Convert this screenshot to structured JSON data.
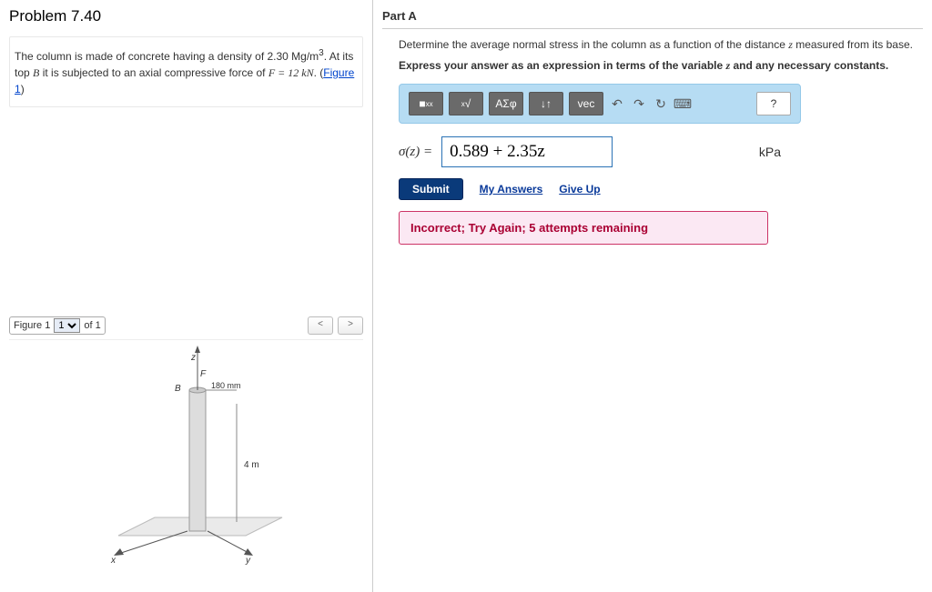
{
  "problem": {
    "title": "Problem 7.40",
    "description_prefix": "The column is made of concrete having a density of 2.30 Mg/m",
    "description_exp": "3",
    "description_mid": ". At its top ",
    "description_var_B": "B",
    "description_after_B": " it is subjected to an axial compressive force of ",
    "description_F": "F = 12 kN",
    "description_suffix": ". (",
    "figure_link_text": "Figure 1",
    "description_close": ")"
  },
  "figure": {
    "label": "Figure 1",
    "selected": "1",
    "of_text": "of 1",
    "prev": "<",
    "next": ">",
    "dim_radius": "180 mm",
    "dim_height": "4 m",
    "axis_x": "x",
    "axis_y": "y",
    "axis_z": "z",
    "label_B": "B",
    "label_F": "F"
  },
  "partA": {
    "title": "Part A",
    "question_prefix": "Determine the average normal stress in the column as a function of the distance ",
    "question_var": "z",
    "question_suffix": " measured from its base.",
    "instruction_prefix": "Express your answer as an expression in terms of the variable ",
    "instruction_var": "z",
    "instruction_suffix": " and any necessary constants.",
    "sigma_label": "σ(z) = ",
    "answer_value": "0.589 + 2.35z",
    "units": "kPa",
    "submit_label": "Submit",
    "my_answers_label": "My Answers",
    "give_up_label": "Give Up",
    "feedback": "Incorrect; Try Again; 5 attempts remaining"
  },
  "toolbar": {
    "templates": "■",
    "root": "√",
    "greek": "ΑΣφ",
    "updown": "↓↑",
    "vec": "vec",
    "undo": "↶",
    "redo": "↷",
    "reset": "↻",
    "keyboard": "⌨",
    "help": "?"
  }
}
